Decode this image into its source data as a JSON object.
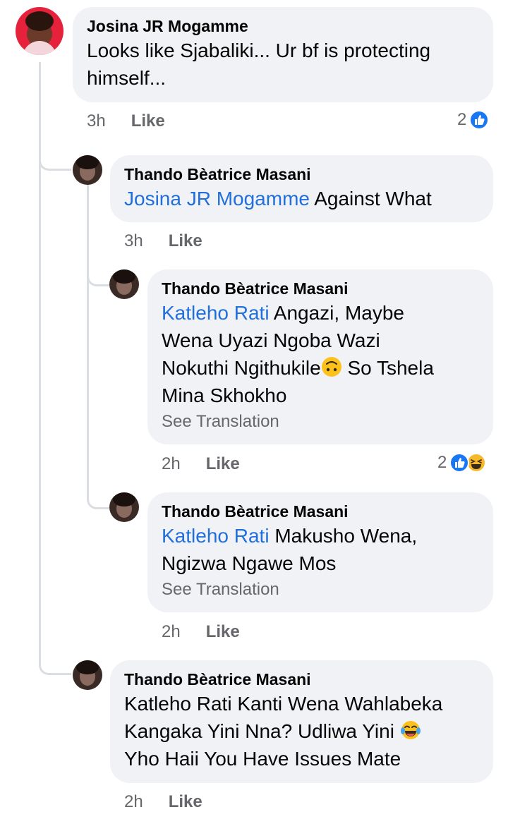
{
  "comments": [
    {
      "author": "Josina JR Mogamme",
      "text": "Looks like Sjabaliki... Ur bf is protecting himself...",
      "text_line1": "Looks like Sjabaliki... Ur bf is protecting",
      "text_line2": "himself...",
      "time": "3h",
      "like_label": "Like",
      "reaction_count": "2",
      "reactions": [
        "like-icon"
      ],
      "avatar": "woman-red-avatar"
    },
    {
      "author": "Thando Bèatrice Masani",
      "mention": "Josina JR Mogamme",
      "text": "Against What",
      "time": "3h",
      "like_label": "Like",
      "avatar": "woman-dark-avatar"
    },
    {
      "author": "Thando Bèatrice Masani",
      "mention": "Katleho Rati",
      "text_line1": "Angazi, Maybe",
      "text_line2": "Wena Uyazi Ngoba Wazi",
      "text_line3a": "Nokuthi Ngithukile",
      "text_line3b": "So Tshela",
      "text_line4": "Mina Skhokho",
      "emoji": "upside-down-face",
      "see_translation": "See Translation",
      "time": "2h",
      "like_label": "Like",
      "reaction_count": "2",
      "reactions": [
        "like-icon",
        "haha-icon"
      ],
      "avatar": "woman-dark-avatar"
    },
    {
      "author": "Thando Bèatrice Masani",
      "mention": "Katleho Rati",
      "text_line1": "Makusho Wena,",
      "text_line2": "Ngizwa Ngawe Mos",
      "see_translation": "See Translation",
      "time": "2h",
      "like_label": "Like",
      "avatar": "woman-dark-avatar"
    },
    {
      "author": "Thando Bèatrice Masani",
      "text_line1": "Katleho Rati Kanti Wena Wahlabeka",
      "text_line2": "Kangaka Yini Nna? Udliwa Yini",
      "text_line3": "Yho Haii You Have Issues Mate",
      "emoji": "tears-of-joy",
      "time": "2h",
      "like_label": "Like",
      "avatar": "woman-dark-avatar"
    }
  ],
  "colors": {
    "bubble": "#f0f2f5",
    "mention": "#216fdb",
    "meta": "#65676b",
    "like_blue": "#1877f2",
    "haha_yellow": "#f7b928"
  }
}
